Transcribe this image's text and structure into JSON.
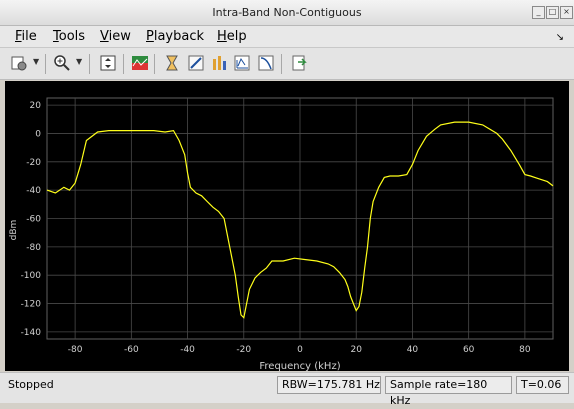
{
  "window": {
    "title": "Intra-Band Non-Contiguous",
    "controls": [
      "minimize-icon",
      "maximize-icon",
      "close-icon"
    ]
  },
  "menu": {
    "items": [
      {
        "label": "File",
        "accel": "F",
        "rest": "ile"
      },
      {
        "label": "Tools",
        "accel": "T",
        "rest": "ools"
      },
      {
        "label": "View",
        "accel": "V",
        "rest": "iew"
      },
      {
        "label": "Playback",
        "accel": "P",
        "rest": "layback"
      },
      {
        "label": "Help",
        "accel": "H",
        "rest": "elp"
      }
    ],
    "dock_icon": "dock-arrow-icon"
  },
  "toolbar": {
    "icons": [
      "settings-icon",
      "zoom-in-icon",
      "scale-axes-icon",
      "spectrum-mode-icon",
      "peak-finder-icon",
      "measure-icon",
      "distortion-icon",
      "ccdf-icon",
      "channel-icon",
      "restore-icon"
    ]
  },
  "plot": {
    "ylabel": "dBm",
    "xlabel": "Frequency (kHz)",
    "trace_color": "#ffff1a"
  },
  "chart_data": {
    "type": "line",
    "xlabel": "Frequency (kHz)",
    "ylabel": "dBm",
    "xlim": [
      -90,
      90
    ],
    "ylim": [
      -145,
      25
    ],
    "xticks": [
      -80,
      -60,
      -40,
      -20,
      0,
      20,
      40,
      60,
      80
    ],
    "yticks": [
      20,
      0,
      -20,
      -40,
      -60,
      -80,
      -100,
      -120,
      -140
    ],
    "grid": true,
    "series": [
      {
        "color": "#ffff1a",
        "x": [
          -90,
          -87,
          -84,
          -82,
          -80,
          -78,
          -76,
          -72,
          -68,
          -64,
          -60,
          -56,
          -52,
          -48,
          -45,
          -43,
          -41,
          -40,
          -39,
          -37,
          -35,
          -33,
          -31,
          -29,
          -27,
          -25,
          -24,
          -23,
          -22,
          -21,
          -20,
          -19,
          -18,
          -16,
          -14,
          -12,
          -10,
          -6,
          -2,
          2,
          6,
          10,
          12,
          14,
          16,
          17,
          18,
          19,
          20,
          21,
          22,
          23,
          24,
          25,
          26,
          28,
          30,
          32,
          35,
          38,
          40,
          42,
          45,
          48,
          50,
          55,
          60,
          65,
          70,
          72,
          75,
          78,
          80,
          82,
          85,
          88,
          90
        ],
        "y": [
          -40,
          -42,
          -38,
          -40,
          -35,
          -22,
          -5,
          1,
          2,
          2,
          2,
          2,
          2,
          1,
          2,
          -5,
          -15,
          -28,
          -38,
          -42,
          -44,
          -48,
          -52,
          -55,
          -60,
          -80,
          -90,
          -100,
          -115,
          -128,
          -130,
          -120,
          -110,
          -102,
          -98,
          -95,
          -90,
          -90,
          -88,
          -89,
          -90,
          -92,
          -94,
          -98,
          -103,
          -108,
          -115,
          -120,
          -125,
          -122,
          -112,
          -95,
          -80,
          -60,
          -48,
          -38,
          -31,
          -30,
          -30,
          -29,
          -22,
          -12,
          -2,
          3,
          6,
          8,
          8,
          6,
          0,
          -4,
          -12,
          -22,
          -29,
          -30,
          -32,
          -34,
          -37
        ]
      }
    ]
  },
  "status": {
    "state": "Stopped",
    "rbw": "RBW=175.781 Hz",
    "sample_rate": "Sample rate=180 kHz",
    "time": "T=0.06"
  }
}
